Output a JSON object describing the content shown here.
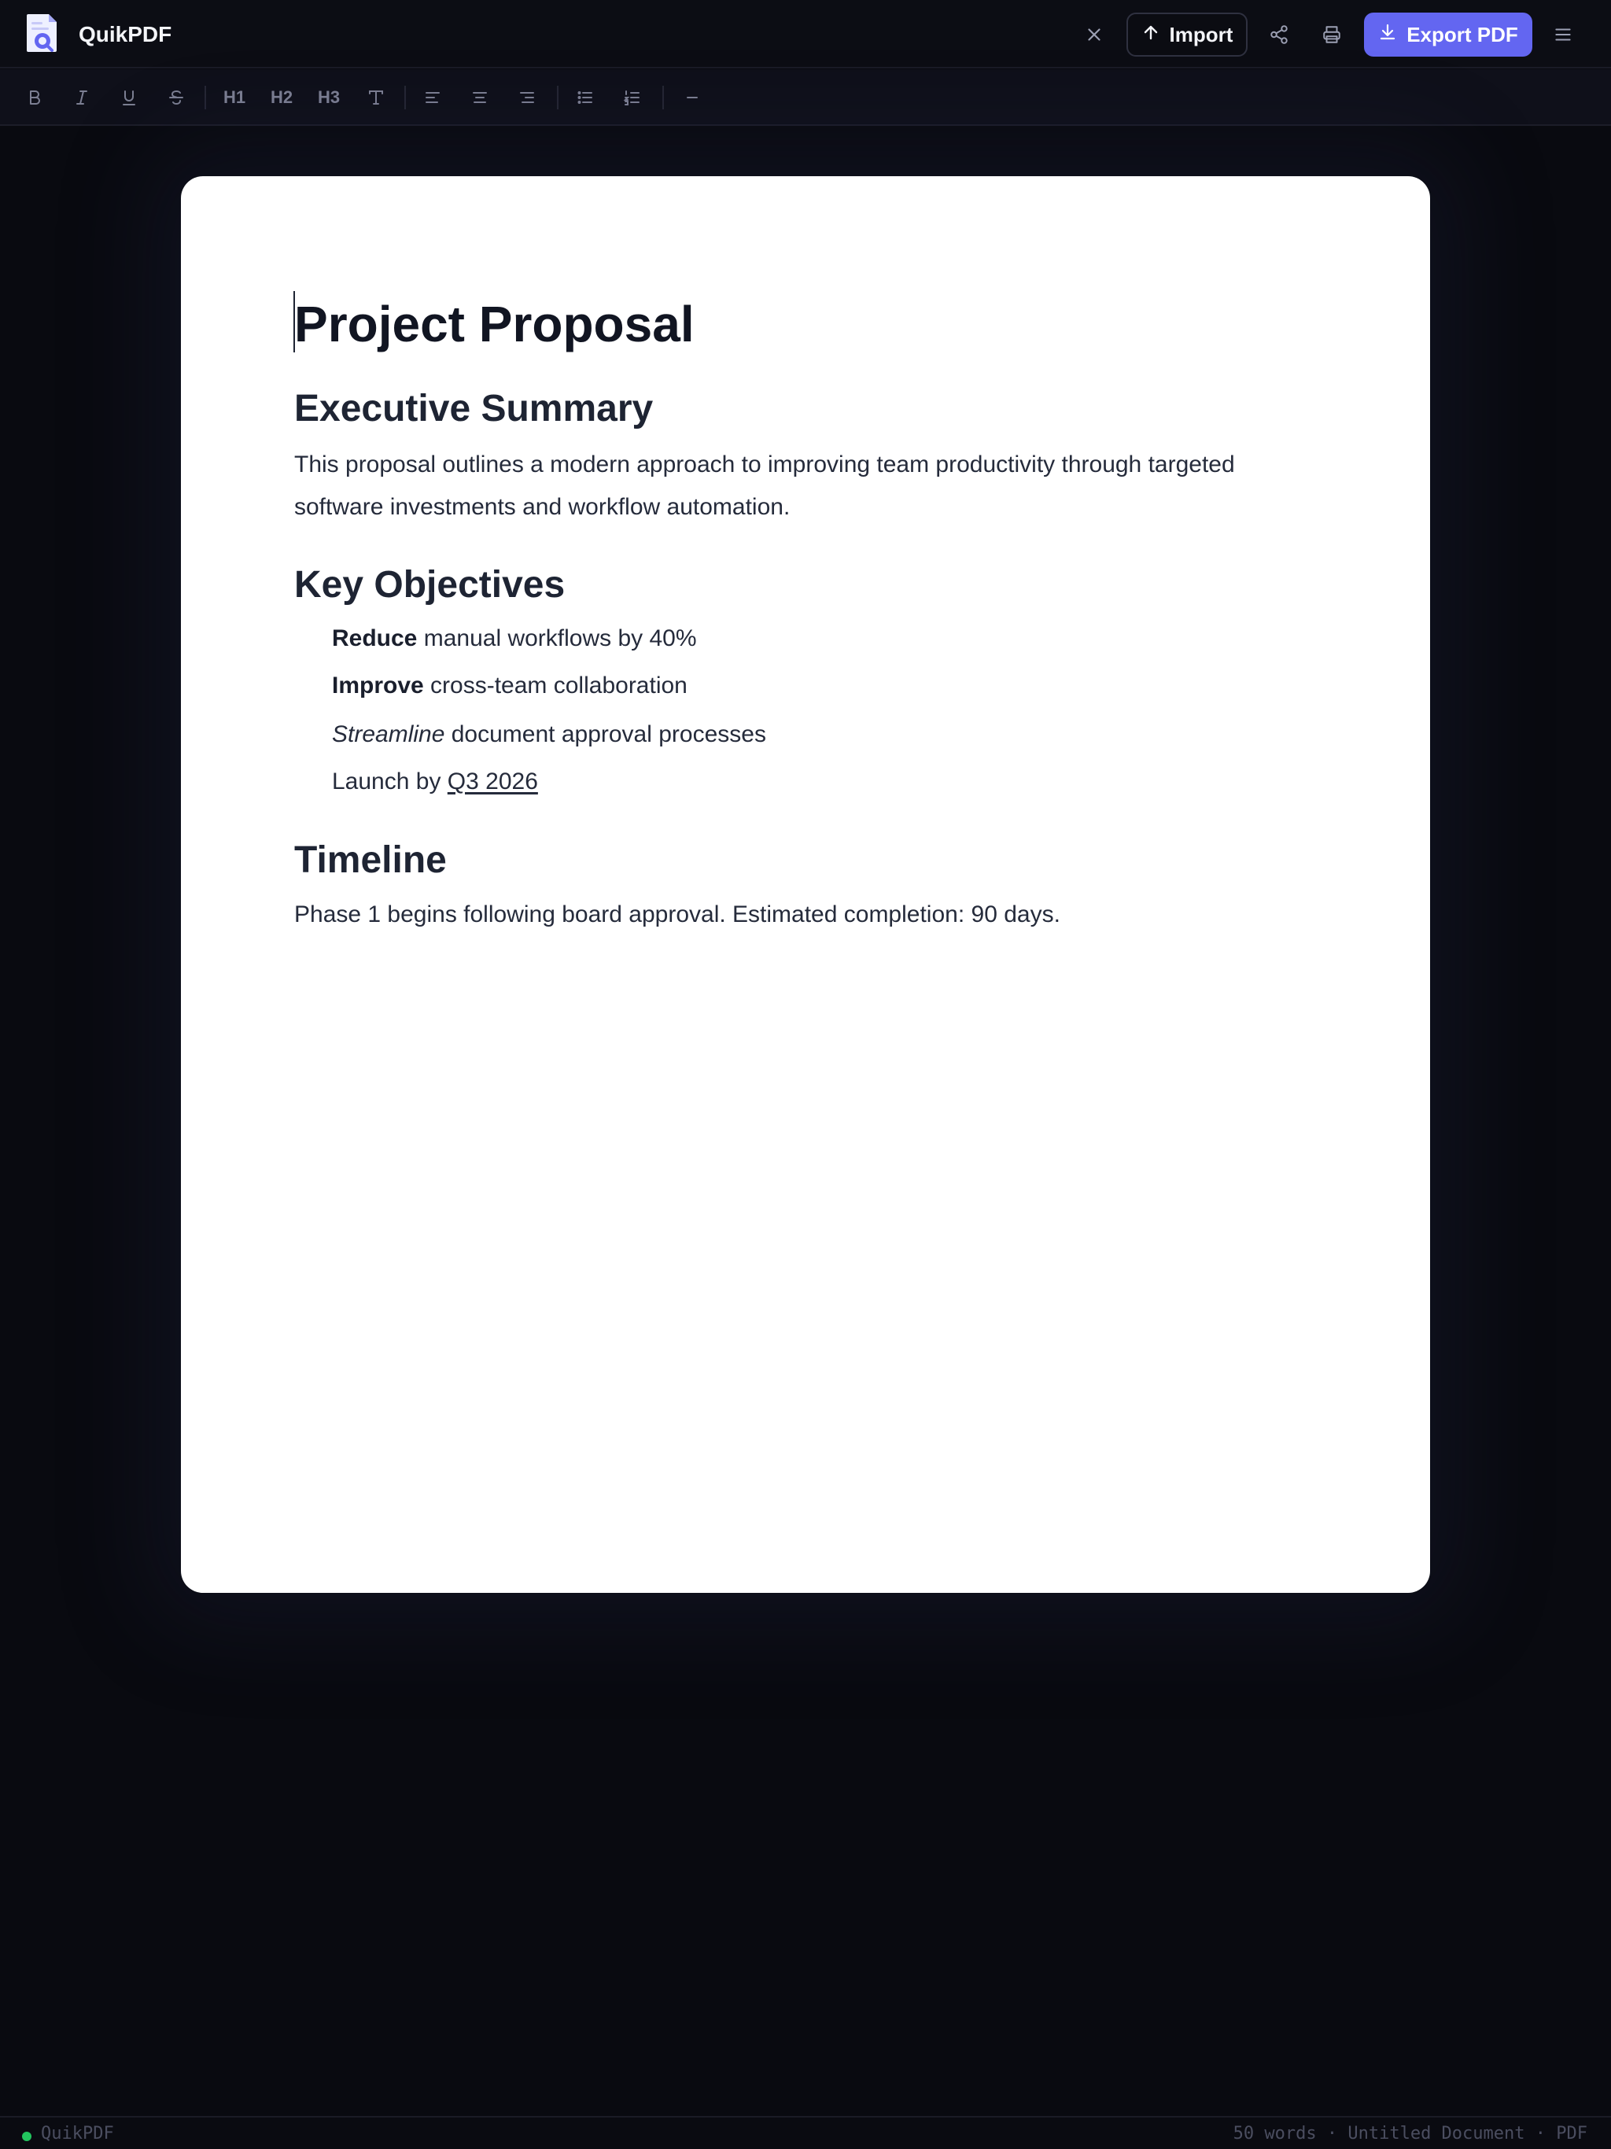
{
  "app": {
    "name": "QuikPDF",
    "accent_color": "#6366f1"
  },
  "header": {
    "import_label": "Import",
    "export_label": "Export PDF",
    "icons": [
      "close-icon",
      "upload-icon",
      "share-icon",
      "printer-icon",
      "download-icon",
      "menu-icon"
    ]
  },
  "toolbar": {
    "h1_label": "H1",
    "h2_label": "H2",
    "h3_label": "H3",
    "icons": [
      "bold-icon",
      "italic-icon",
      "underline-icon",
      "strikethrough-icon",
      "text-icon",
      "align-left-icon",
      "align-center-icon",
      "align-right-icon",
      "bullet-list-icon",
      "numbered-list-icon",
      "horizontal-rule-icon"
    ]
  },
  "document": {
    "title": "Project Proposal",
    "sections": [
      {
        "heading": "Executive Summary",
        "body": "This proposal outlines a modern approach to improving team productivity through targeted software investments and workflow automation."
      },
      {
        "heading": "Key Objectives",
        "items": [
          {
            "emphasis": "Reduce",
            "rest": " manual workflows by 40%"
          },
          {
            "emphasis": "Improve",
            "rest": " cross-team collaboration"
          },
          {
            "emphasis": "Streamline",
            "rest": " document approval processes"
          },
          {
            "prefix": "Launch by ",
            "emphasis": "Q3 2026"
          }
        ]
      },
      {
        "heading": "Timeline",
        "body": "Phase 1 begins following board approval. Estimated completion: 90 days."
      }
    ]
  },
  "status": {
    "app_label": "QuikPDF",
    "summary": "50 words · Untitled Document · PDF",
    "indicator_color": "#22c55e"
  }
}
